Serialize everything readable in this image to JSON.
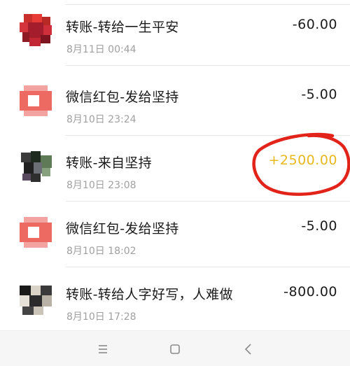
{
  "transactions": [
    {
      "title": "转账-转给一生平安",
      "time": "8月11日 00:44",
      "amount": "-60.00",
      "avatar": "red-photo"
    },
    {
      "title": "微信红包-发给坚持",
      "time": "8月10日 23:24",
      "amount": "-5.00",
      "avatar": "red-packet"
    },
    {
      "title": "转账-来自坚持",
      "time": "8月10日 23:08",
      "amount": "+2500.00",
      "avatar": "dark-photo"
    },
    {
      "title": "微信红包-发给坚持",
      "time": "8月10日 18:02",
      "amount": "-5.00",
      "avatar": "red-packet"
    },
    {
      "title": "转账-转给人字好写，人难做",
      "time": "8月10日 17:28",
      "amount": "-800.00",
      "avatar": "bw-photo"
    }
  ],
  "navbar": {
    "menu_icon": "menu-icon",
    "home_icon": "home-square-icon",
    "back_icon": "back-chevron-icon"
  },
  "colors": {
    "income": "#e8b81e",
    "annotation": "#e2231a",
    "expense": "#1b1b1b",
    "timestamp": "#a0a0a0"
  }
}
